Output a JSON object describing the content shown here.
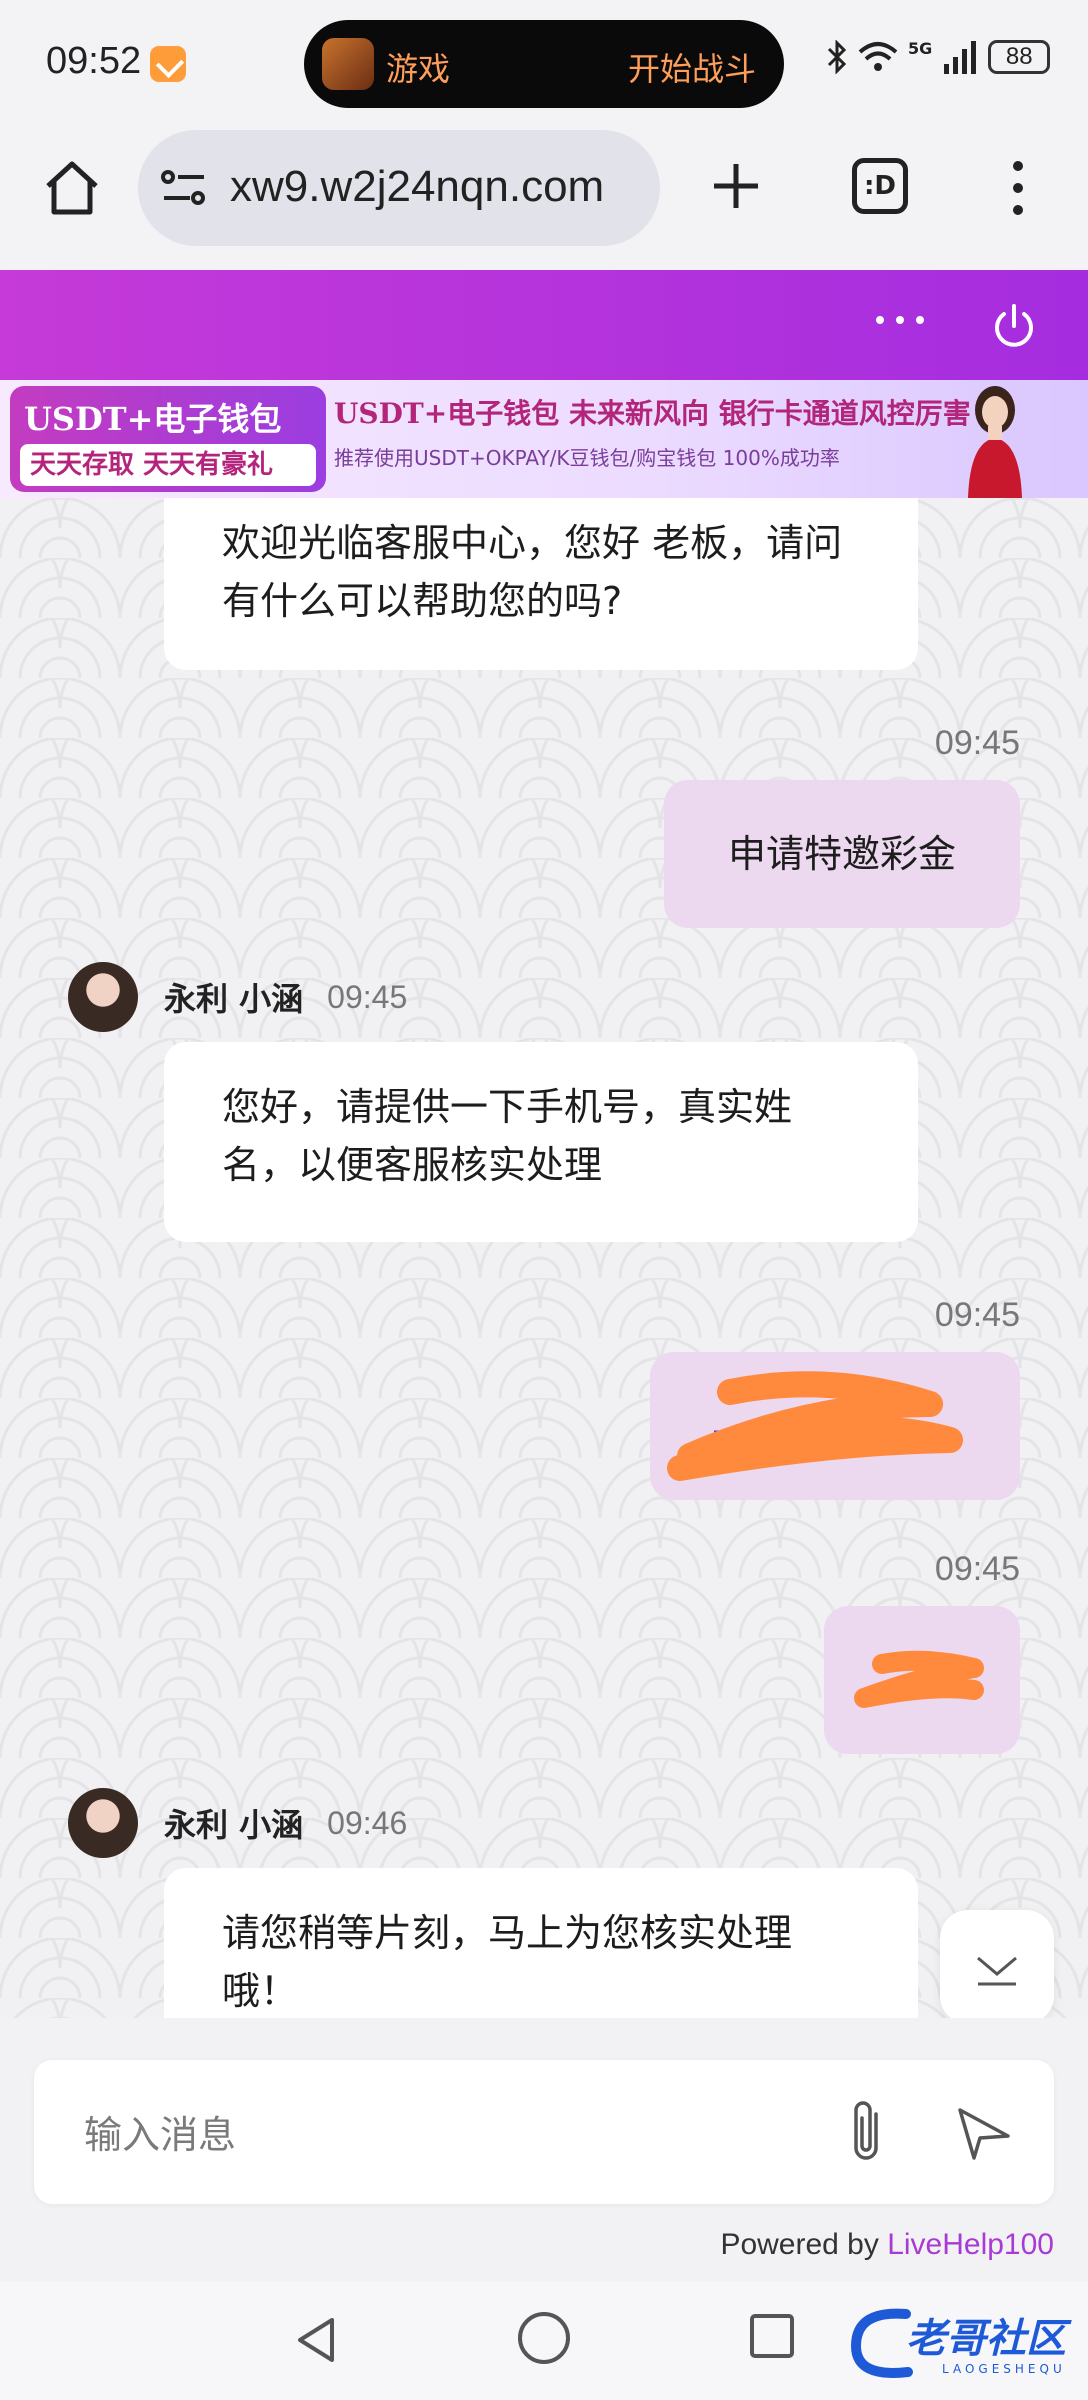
{
  "status_bar": {
    "time": "09:52",
    "island_label": "游戏",
    "island_cta": "开始战斗",
    "network": "5G",
    "battery": "88"
  },
  "browser": {
    "url": "xw9.w2j24nqn.com",
    "tabs_icon_label": ":D"
  },
  "ad_banner": {
    "left_title": "USDT+电子钱包",
    "left_subtitle": "天天存取 天天有豪礼",
    "main_title": "USDT+电子钱包  未来新风向  银行卡通道风控厉害",
    "main_subtitle": "推荐使用USDT+OKPAY/K豆钱包/购宝钱包   100%成功率"
  },
  "messages": {
    "m1_text": "欢迎光临客服中心，您好 老板，请问有什么可以帮助您的吗?",
    "m2_time": "09:45",
    "m2_text": "申请特邀彩金",
    "m3_sender": "永利 小涵",
    "m3_time": "09:45",
    "m3_text": "您好，请提供一下手机号，真实姓名，以便客服核实处理",
    "m4_time": "09:45",
    "m5_time": "09:45",
    "m6_sender": "永利 小涵",
    "m6_time": "09:46",
    "m6_text": "请您稍等片刻，马上为您核实处理哦！"
  },
  "composer": {
    "placeholder": "输入消息"
  },
  "footer": {
    "powered_prefix": "Powered by ",
    "powered_brand": "LiveHelp100"
  },
  "watermark": {
    "text": "老哥社区",
    "sub": "LAOGESHEQU"
  },
  "colors": {
    "accent_purple": "#b535dc",
    "outgoing_bubble": "#ecd8ef",
    "redaction": "#ff8a3d"
  }
}
